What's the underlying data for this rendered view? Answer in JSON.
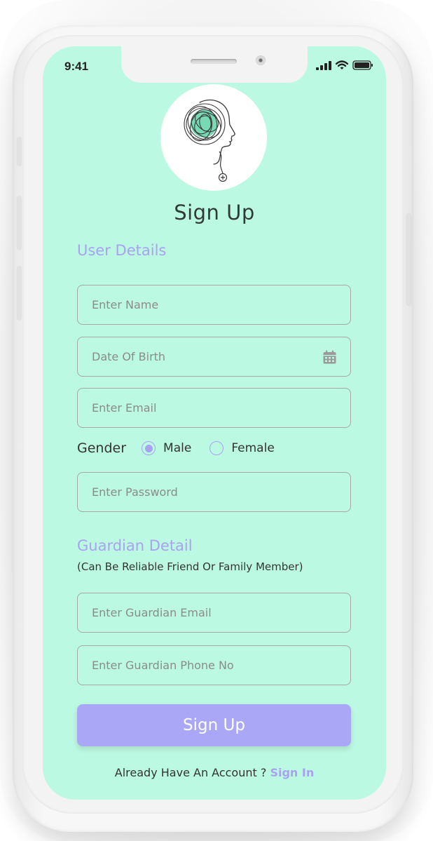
{
  "status_bar": {
    "time": "9:41",
    "icons": [
      "signal-icon",
      "wifi-icon",
      "battery-icon"
    ]
  },
  "logo": {
    "icon": "head-brain-logo-icon"
  },
  "page_title": "Sign Up",
  "user_details": {
    "heading": "User Details",
    "name_placeholder": "Enter Name",
    "dob_placeholder": "Date Of Birth",
    "dob_icon": "calendar-icon",
    "email_placeholder": "Enter Email",
    "gender_label": "Gender",
    "gender_options": [
      "Male",
      "Female"
    ],
    "gender_selected": "Male",
    "password_placeholder": "Enter Password"
  },
  "guardian": {
    "heading": "Guardian Detail",
    "subheading": "(Can Be Reliable Friend Or Family Member)",
    "email_placeholder": "Enter Guardian Email",
    "phone_placeholder": "Enter Guardian Phone No"
  },
  "submit_label": "Sign Up",
  "footer": {
    "prompt": "Already Have An Account ?",
    "link": "Sign In"
  },
  "colors": {
    "screen_background": "#bcf9e2",
    "accent": "#a9a2f2",
    "button": "#aaa7f6",
    "field_border": "#a7a7a7"
  }
}
